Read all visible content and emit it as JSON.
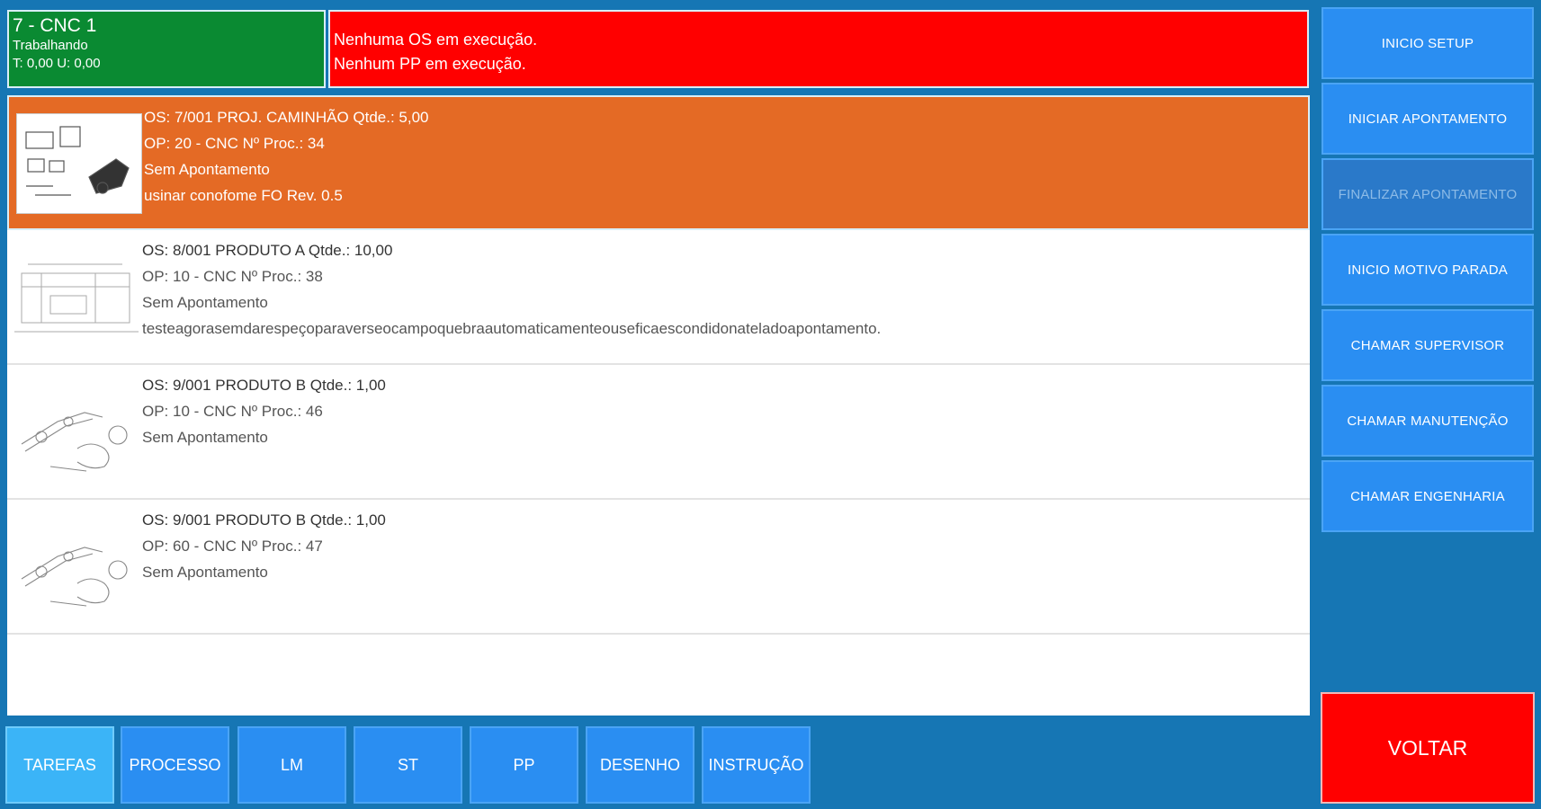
{
  "machine": {
    "name": "7 - CNC 1",
    "state": "Trabalhando",
    "times": "T: 0,00 U: 0,00"
  },
  "alert": {
    "line1": "Nenhuma OS em execução.",
    "line2": "Nenhum PP em execução."
  },
  "tasks": [
    {
      "os": "OS: 7/001 PROJ. CAMINHÃO Qtde.: 5,00",
      "op": "OP: 20 - CNC Nº Proc.: 34",
      "status": "Sem Apontamento",
      "note": "usinar conofome FO Rev. 0.5"
    },
    {
      "os": "OS: 8/001 PRODUTO A Qtde.: 10,00",
      "op": "OP: 10 - CNC Nº Proc.: 38",
      "status": "Sem Apontamento",
      "note": "testeagorasemdarespeçoparaverseocampoquebraautomaticamenteouseficaescondidonateladoapontamento."
    },
    {
      "os": "OS: 9/001 PRODUTO B Qtde.: 1,00",
      "op": "OP: 10 - CNC Nº Proc.: 46",
      "status": "Sem Apontamento",
      "note": ""
    },
    {
      "os": "OS: 9/001 PRODUTO B Qtde.: 1,00",
      "op": "OP: 60 - CNC Nº Proc.: 47",
      "status": "Sem Apontamento",
      "note": ""
    }
  ],
  "side_buttons": {
    "inicio_setup": "INICIO SETUP",
    "iniciar_apontamento": "INICIAR APONTAMENTO",
    "finalizar_apontamento": "FINALIZAR APONTAMENTO",
    "inicio_motivo_parada": "INICIO MOTIVO PARADA",
    "chamar_supervisor": "CHAMAR SUPERVISOR",
    "chamar_manutencao": "CHAMAR MANUTENÇÃO",
    "chamar_engenharia": "CHAMAR ENGENHARIA"
  },
  "back_label": "VOLTAR",
  "tabs": [
    "TAREFAS",
    "PROCESSO",
    "LM",
    "ST",
    "PP",
    "DESENHO",
    "INSTRUÇÃO"
  ],
  "active_tab": "TAREFAS",
  "colors": {
    "background": "#1676b4",
    "machine_status": "#0a8a32",
    "alert": "#ff0000",
    "selected_row": "#e46a25",
    "button": "#2a8ef2",
    "active_tab": "#3bb4f7",
    "back_button": "#ff0000"
  },
  "icons": [
    "drawing-thumbnail-icon"
  ]
}
